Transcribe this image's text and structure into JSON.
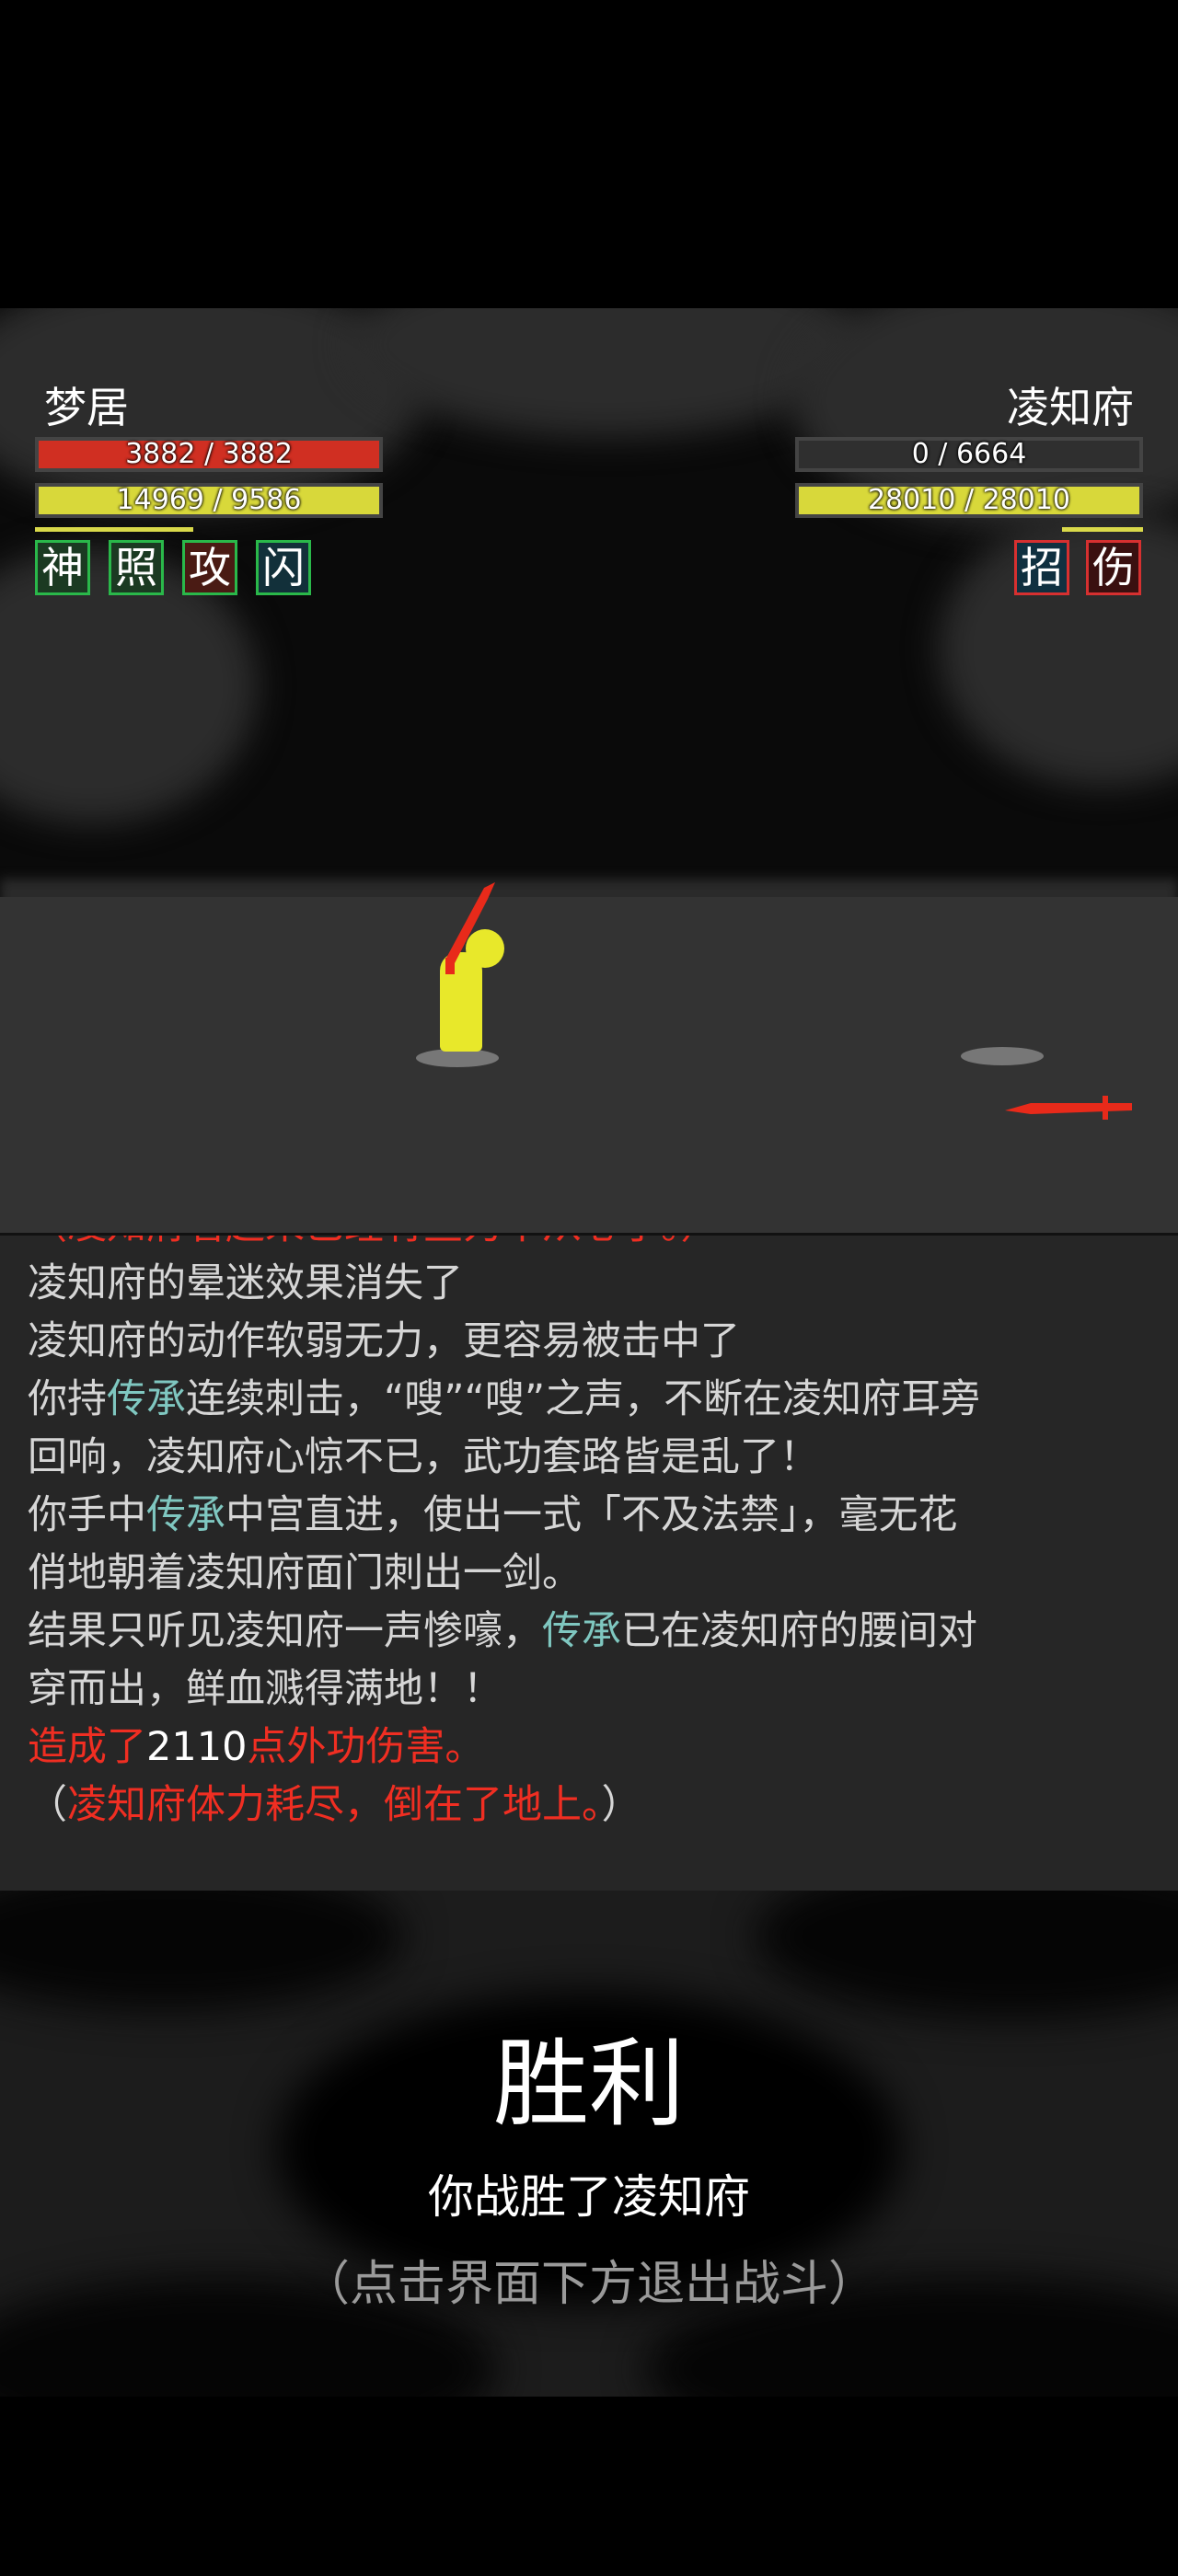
{
  "player": {
    "name": "梦居",
    "hp_text": "3882 / 3882",
    "hp_fraction": 1.0,
    "mp_text": "14969 / 9586",
    "mp_fraction": 1.0,
    "skills": [
      "神",
      "照",
      "攻",
      "闪"
    ]
  },
  "enemy": {
    "name": "凌知府",
    "hp_text": "0 / 6664",
    "hp_fraction": 0.0,
    "mp_text": "28010 / 28010",
    "mp_fraction": 1.0,
    "skills": [
      "招",
      "伤"
    ]
  },
  "log": {
    "lines": [
      [
        {
          "t": "（凌知府看起来已经有些力不从心了。）",
          "c": "red"
        }
      ],
      [
        {
          "t": "凌知府的晕迷效果消失了",
          "c": ""
        }
      ],
      [
        {
          "t": "凌知府的动作软弱无力，更容易被击中了",
          "c": ""
        }
      ],
      [
        {
          "t": "你持",
          "c": ""
        },
        {
          "t": "传承",
          "c": "hl"
        },
        {
          "t": "连续刺击，“嗖”“嗖”之声，不断在凌知府耳旁",
          "c": ""
        }
      ],
      [
        {
          "t": "回响，凌知府心惊不已，武功套路皆是乱了！",
          "c": ""
        }
      ],
      [
        {
          "t": "你手中",
          "c": ""
        },
        {
          "t": "传承",
          "c": "hl"
        },
        {
          "t": "中宫直进，使出一式「不及法禁」，毫无花",
          "c": ""
        }
      ],
      [
        {
          "t": "俏地朝着凌知府面门刺出一剑。",
          "c": ""
        }
      ],
      [
        {
          "t": "结果只听见凌知府一声惨嚎，",
          "c": ""
        },
        {
          "t": "传承",
          "c": "hl"
        },
        {
          "t": "已在凌知府的腰间对",
          "c": ""
        }
      ],
      [
        {
          "t": "穿而出，鲜血溅得满地！！",
          "c": ""
        }
      ],
      [
        {
          "t": "造成了",
          "c": "red"
        },
        {
          "t": "2110",
          "c": "white"
        },
        {
          "t": "点外功伤害。",
          "c": "red"
        }
      ],
      [
        {
          "t": "（",
          "c": ""
        },
        {
          "t": "凌知府体力耗尽，倒在了地上。",
          "c": "red"
        },
        {
          "t": "）",
          "c": ""
        }
      ]
    ]
  },
  "result": {
    "title": "胜利",
    "message": "你战胜了凌知府",
    "hint": "（点击界面下方退出战斗）"
  },
  "colors": {
    "hp_bar": "#d02f22",
    "mp_bar": "#d8d83a",
    "highlight_text": "#7fc7c0",
    "damage_text": "#f02e22",
    "fighter": "#e8e82a",
    "weapon": "#e82a1a"
  }
}
